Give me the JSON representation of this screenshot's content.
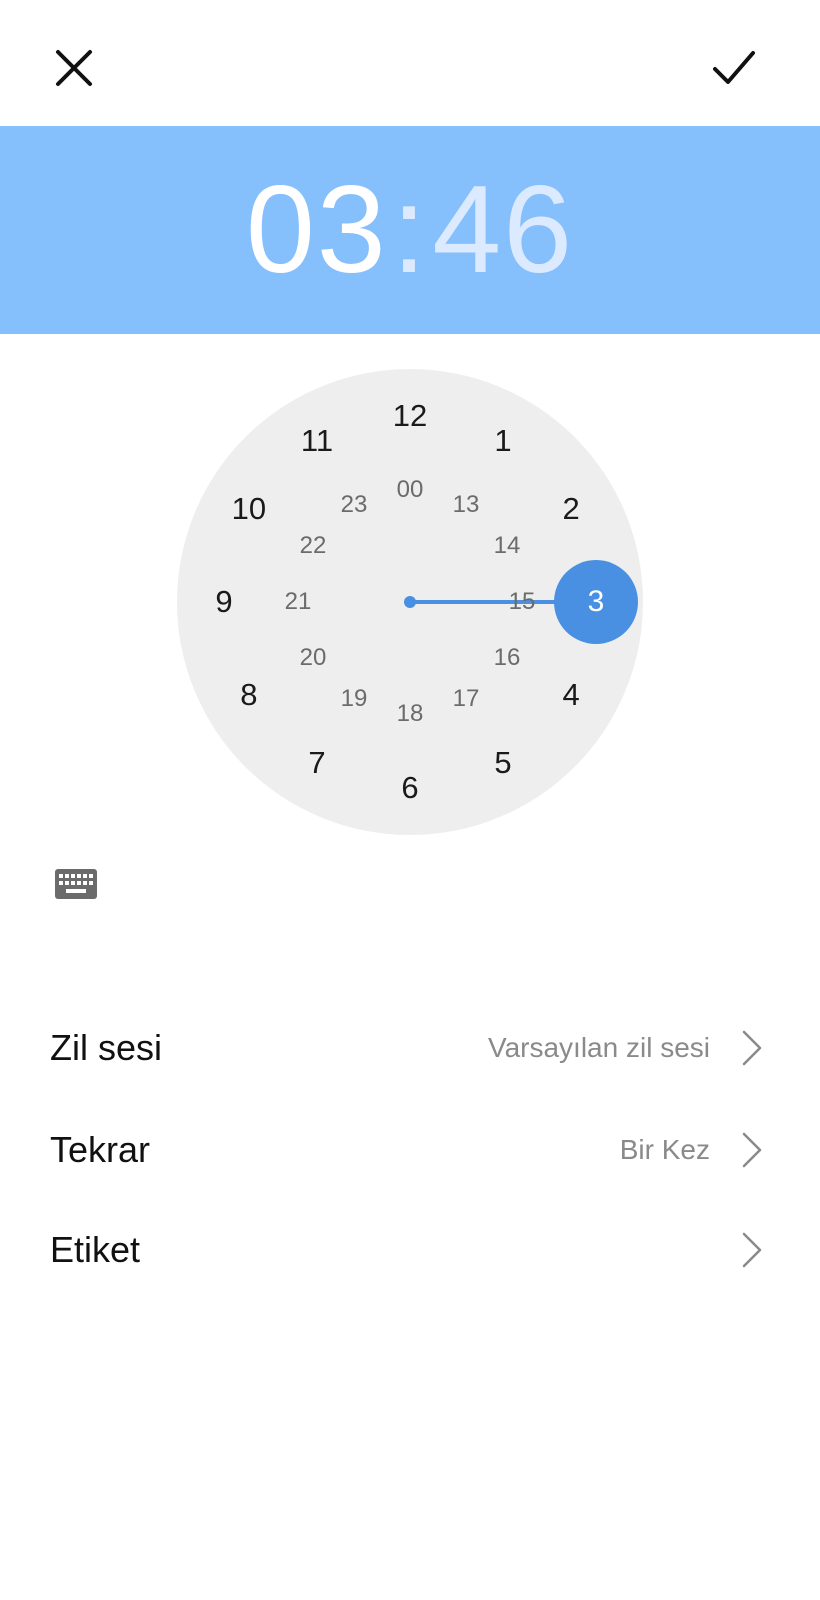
{
  "toolbar": {
    "close_icon": "close-icon",
    "confirm_icon": "check-icon"
  },
  "time": {
    "hour": "03",
    "separator": ":",
    "minute": "46"
  },
  "dial": {
    "mode": "hours",
    "selected": "3",
    "outer": [
      "12",
      "1",
      "2",
      "3",
      "4",
      "5",
      "6",
      "7",
      "8",
      "9",
      "10",
      "11"
    ],
    "inner": [
      "00",
      "13",
      "14",
      "15",
      "16",
      "17",
      "18",
      "19",
      "20",
      "21",
      "22",
      "23"
    ],
    "colors": {
      "face": "#eeeeee",
      "accent": "#4a90e2",
      "header": "#85bffc"
    }
  },
  "keyboard": {
    "icon": "keyboard-icon"
  },
  "settings": {
    "rows": [
      {
        "label": "Zil sesi",
        "value": "Varsayılan zil sesi"
      },
      {
        "label": "Tekrar",
        "value": "Bir Kez"
      },
      {
        "label": "Etiket",
        "value": ""
      }
    ]
  }
}
